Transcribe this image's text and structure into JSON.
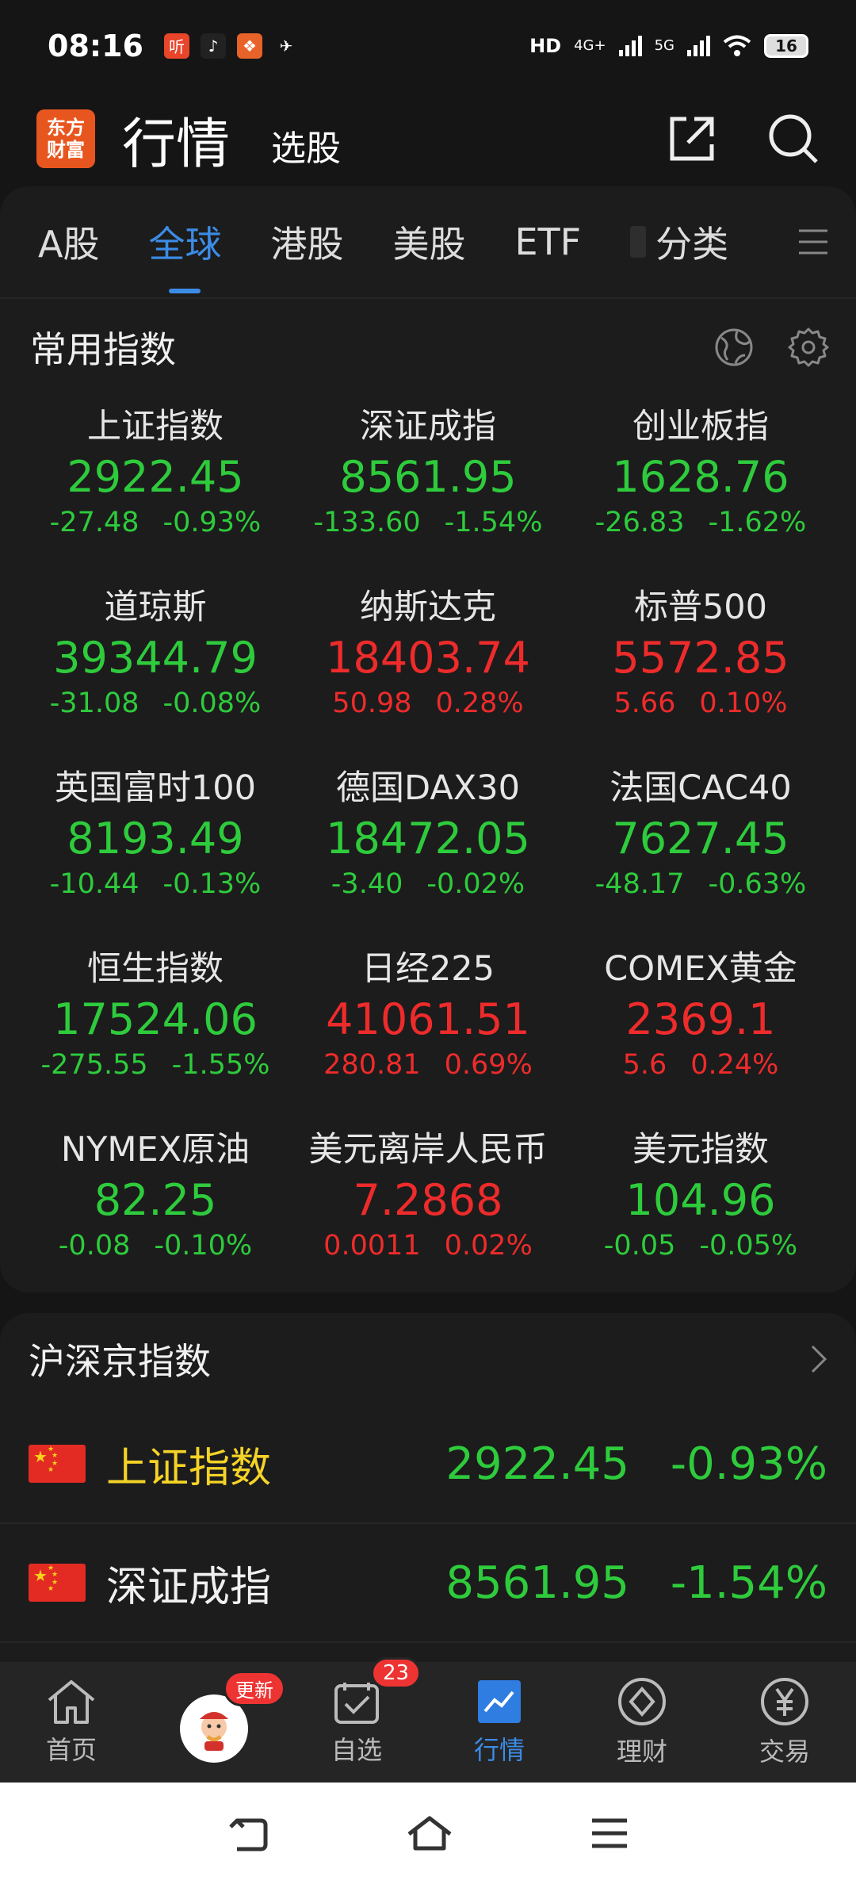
{
  "status": {
    "time": "08:16",
    "apps": [
      {
        "name": "listen-app-icon",
        "glyph": "听",
        "color": "#e8452a"
      },
      {
        "name": "tiktok-app-icon",
        "glyph": "♪",
        "color": "#222222"
      },
      {
        "name": "game-app-icon",
        "glyph": "❖",
        "color": "#e8632a"
      },
      {
        "name": "feather-app-icon",
        "glyph": "✈",
        "color": "#151515"
      }
    ],
    "hd": "HD",
    "network1": "4G+",
    "network2": "5G",
    "battery": "16"
  },
  "header": {
    "logo_line1": "东方",
    "logo_line2": "财富",
    "title": "行情",
    "subtitle": "选股"
  },
  "tabs": [
    "A股",
    "全球",
    "港股",
    "美股",
    "ETF",
    "分类"
  ],
  "active_tab": "全球",
  "section": {
    "title": "常用指数"
  },
  "indices": [
    {
      "name": "上证指数",
      "price": "2922.45",
      "change": "-27.48",
      "pct": "-0.93%",
      "dir": "down"
    },
    {
      "name": "深证成指",
      "price": "8561.95",
      "change": "-133.60",
      "pct": "-1.54%",
      "dir": "down"
    },
    {
      "name": "创业板指",
      "price": "1628.76",
      "change": "-26.83",
      "pct": "-1.62%",
      "dir": "down"
    },
    {
      "name": "道琼斯",
      "price": "39344.79",
      "change": "-31.08",
      "pct": "-0.08%",
      "dir": "down"
    },
    {
      "name": "纳斯达克",
      "price": "18403.74",
      "change": "50.98",
      "pct": "0.28%",
      "dir": "up"
    },
    {
      "name": "标普500",
      "price": "5572.85",
      "change": "5.66",
      "pct": "0.10%",
      "dir": "up"
    },
    {
      "name": "英国富时100",
      "price": "8193.49",
      "change": "-10.44",
      "pct": "-0.13%",
      "dir": "down"
    },
    {
      "name": "德国DAX30",
      "price": "18472.05",
      "change": "-3.40",
      "pct": "-0.02%",
      "dir": "down"
    },
    {
      "name": "法国CAC40",
      "price": "7627.45",
      "change": "-48.17",
      "pct": "-0.63%",
      "dir": "down"
    },
    {
      "name": "恒生指数",
      "price": "17524.06",
      "change": "-275.55",
      "pct": "-1.55%",
      "dir": "down"
    },
    {
      "name": "日经225",
      "price": "41061.51",
      "change": "280.81",
      "pct": "0.69%",
      "dir": "up"
    },
    {
      "name": "COMEX黄金",
      "price": "2369.1",
      "change": "5.6",
      "pct": "0.24%",
      "dir": "up"
    },
    {
      "name": "NYMEX原油",
      "price": "82.25",
      "change": "-0.08",
      "pct": "-0.10%",
      "dir": "down"
    },
    {
      "name": "美元离岸人民币",
      "price": "7.2868",
      "change": "0.0011",
      "pct": "0.02%",
      "dir": "up"
    },
    {
      "name": "美元指数",
      "price": "104.96",
      "change": "-0.05",
      "pct": "-0.05%",
      "dir": "down"
    }
  ],
  "hsj": {
    "title": "沪深京指数",
    "rows": [
      {
        "name": "上证指数",
        "price": "2922.45",
        "pct": "-0.93%",
        "name_color": "#f5d327"
      },
      {
        "name": "深证成指",
        "price": "8561.95",
        "pct": "-1.54%",
        "name_color": "#f0f0f0"
      }
    ]
  },
  "nav": {
    "home": "首页",
    "mascot_badge": "更新",
    "watchlist": "自选",
    "watchlist_badge": "23",
    "market": "行情",
    "wealth": "理财",
    "trade": "交易"
  },
  "colors": {
    "up": "#ee2b2b",
    "down": "#2ecb3c",
    "accent": "#3c8ce6"
  }
}
